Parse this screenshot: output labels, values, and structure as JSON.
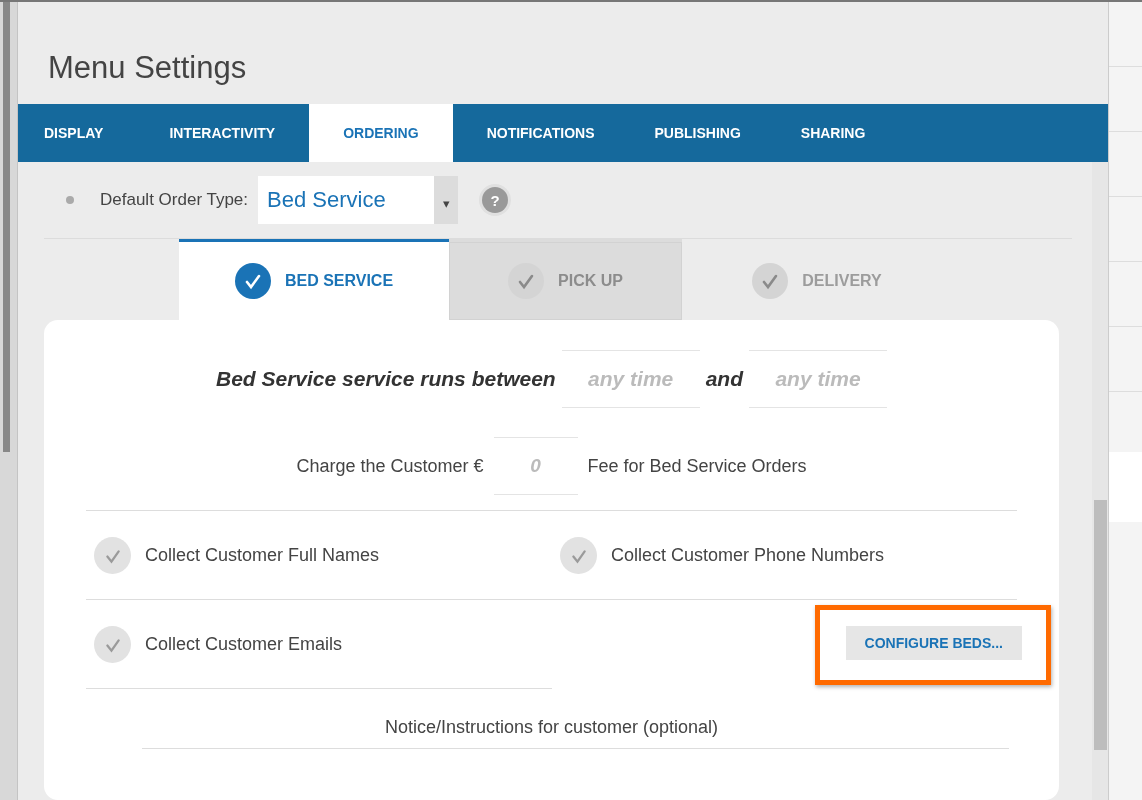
{
  "window": {
    "title": "Menu Settings"
  },
  "tabs": [
    {
      "label": "DISPLAY",
      "selected": false
    },
    {
      "label": "INTERACTIVITY",
      "selected": false
    },
    {
      "label": "ORDERING",
      "selected": true
    },
    {
      "label": "NOTIFICATIONS",
      "selected": false
    },
    {
      "label": "PUBLISHING",
      "selected": false
    },
    {
      "label": "SHARING",
      "selected": false
    }
  ],
  "default_order_type": {
    "label": "Default Order Type:",
    "value": "Bed Service",
    "arrow": "▾",
    "help": "?"
  },
  "order_types": [
    {
      "label": "BED SERVICE",
      "selected": true,
      "hovered": false
    },
    {
      "label": "PICK UP",
      "selected": false,
      "hovered": true
    },
    {
      "label": "DELIVERY",
      "selected": false,
      "hovered": false
    }
  ],
  "schedule": {
    "label": "Bed Service service runs between",
    "from_placeholder": "any time",
    "joiner": "and",
    "to_placeholder": "any time"
  },
  "fee": {
    "label": "Charge the Customer €",
    "placeholder": "0",
    "suffix": "Fee for Bed Service Orders"
  },
  "options": [
    {
      "label": "Collect Customer Full Names",
      "checked": false
    },
    {
      "label": "Collect Customer Phone Numbers",
      "checked": false
    },
    {
      "label": "Collect Customer Emails",
      "checked": false
    }
  ],
  "configure_button": {
    "label": "CONFIGURE BEDS...",
    "highlighted": true
  },
  "notice": {
    "label": "Notice/Instructions for customer (optional)"
  }
}
